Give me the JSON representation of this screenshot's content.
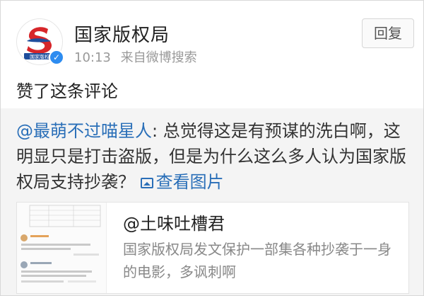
{
  "post": {
    "user_name": "国家版权局",
    "time": "10:13",
    "source": "来自微博搜索",
    "reply_label": "回复",
    "action_text": "赞了这条评论"
  },
  "quoted": {
    "mention": "@最萌不过喵星人",
    "text": ": 总觉得这是有预谋的洗白啊，这明显只是打击盗版，但是为什么这么多人认为国家版权局支持抄袭？",
    "pics_label": "查看图片"
  },
  "card": {
    "title": "@土味吐槽君",
    "desc": "国家版权局发文保护一部集各种抄袭于一身的电影，多讽刺啊"
  },
  "colors": {
    "link": "#2a6fb8",
    "logo_red": "#d7262a",
    "logo_blue": "#1f4e9c",
    "verified": "#2d8cf0"
  },
  "icons": {
    "verified": "verified-badge-icon",
    "pictures": "picture-icon"
  }
}
